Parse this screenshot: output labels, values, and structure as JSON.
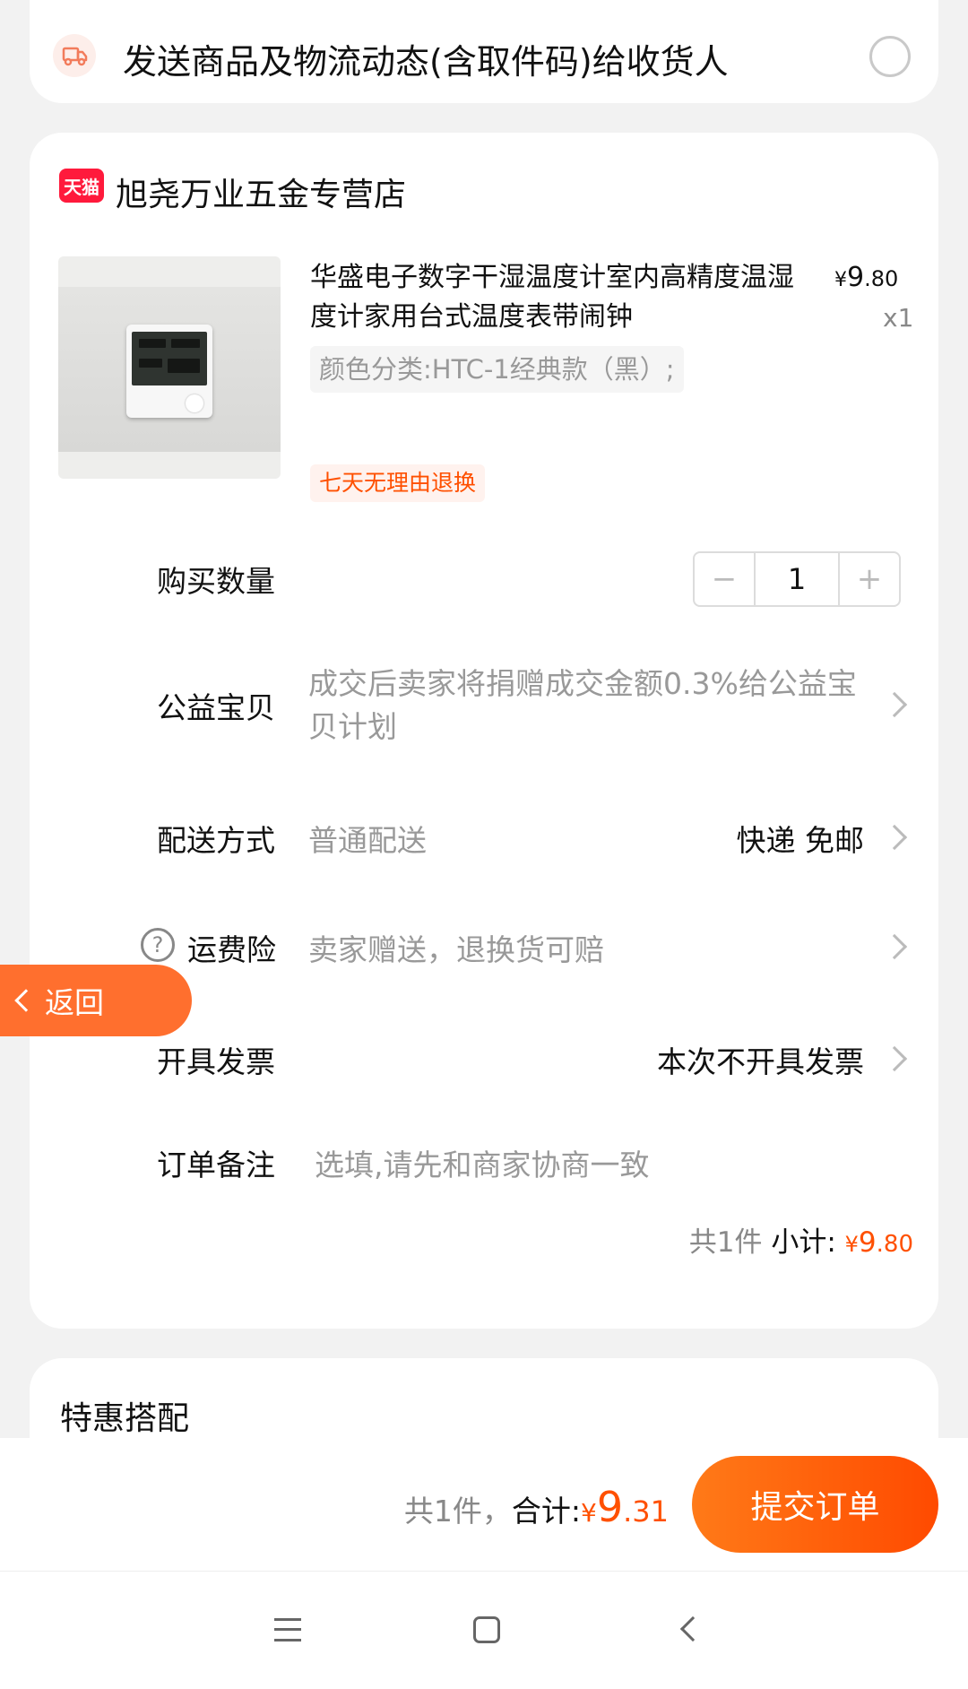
{
  "notify": {
    "text": "发送商品及物流动态(含取件码)给收货人",
    "icon": "truck-icon",
    "checked": false
  },
  "shop": {
    "logo_text": "天猫",
    "name": "旭尧万业五金专营店"
  },
  "product": {
    "title": "华盛电子数字干湿温度计室内高精度温湿度计家用台式温度表带闹钟",
    "price_symbol": "¥",
    "price_int": "9",
    "price_dec": ".80",
    "quantity_text": "x1",
    "sku": "颜色分类:HTC-1经典款（黑）;",
    "return_badge": "七天无理由退换"
  },
  "quantity": {
    "label": "购买数量",
    "minus": "−",
    "value": "1",
    "plus": "+"
  },
  "charity": {
    "label": "公益宝贝",
    "text": "成交后卖家将捐赠成交金额0.3%给公益宝贝计划"
  },
  "delivery": {
    "label": "配送方式",
    "value": "普通配送",
    "right": "快递 免邮"
  },
  "insurance": {
    "label": "运费险",
    "help_glyph": "?",
    "value": "卖家赠送，退换货可赔"
  },
  "invoice": {
    "label": "开具发票",
    "right": "本次不开具发票"
  },
  "remark": {
    "label": "订单备注",
    "placeholder": "选填,请先和商家协商一致"
  },
  "subtotal": {
    "count": "共1件",
    "label": " 小计: ",
    "symbol": "¥",
    "int": "9",
    "dec": ".80"
  },
  "bargain": {
    "title": "特惠搭配"
  },
  "back_button": {
    "label": "返回"
  },
  "footer": {
    "count": "共1件，",
    "label": "合计:",
    "symbol": "¥",
    "int": "9",
    "dec": ".31",
    "submit": "提交订单"
  },
  "nav": {
    "menu_icon": "menu-icon",
    "home_icon": "home-icon",
    "back_icon": "back-icon"
  },
  "colors": {
    "accent": "#ff5000",
    "tmall": "#ff1a3c",
    "submit_gradient_start": "#ff7a18",
    "submit_gradient_end": "#ff4a00"
  }
}
